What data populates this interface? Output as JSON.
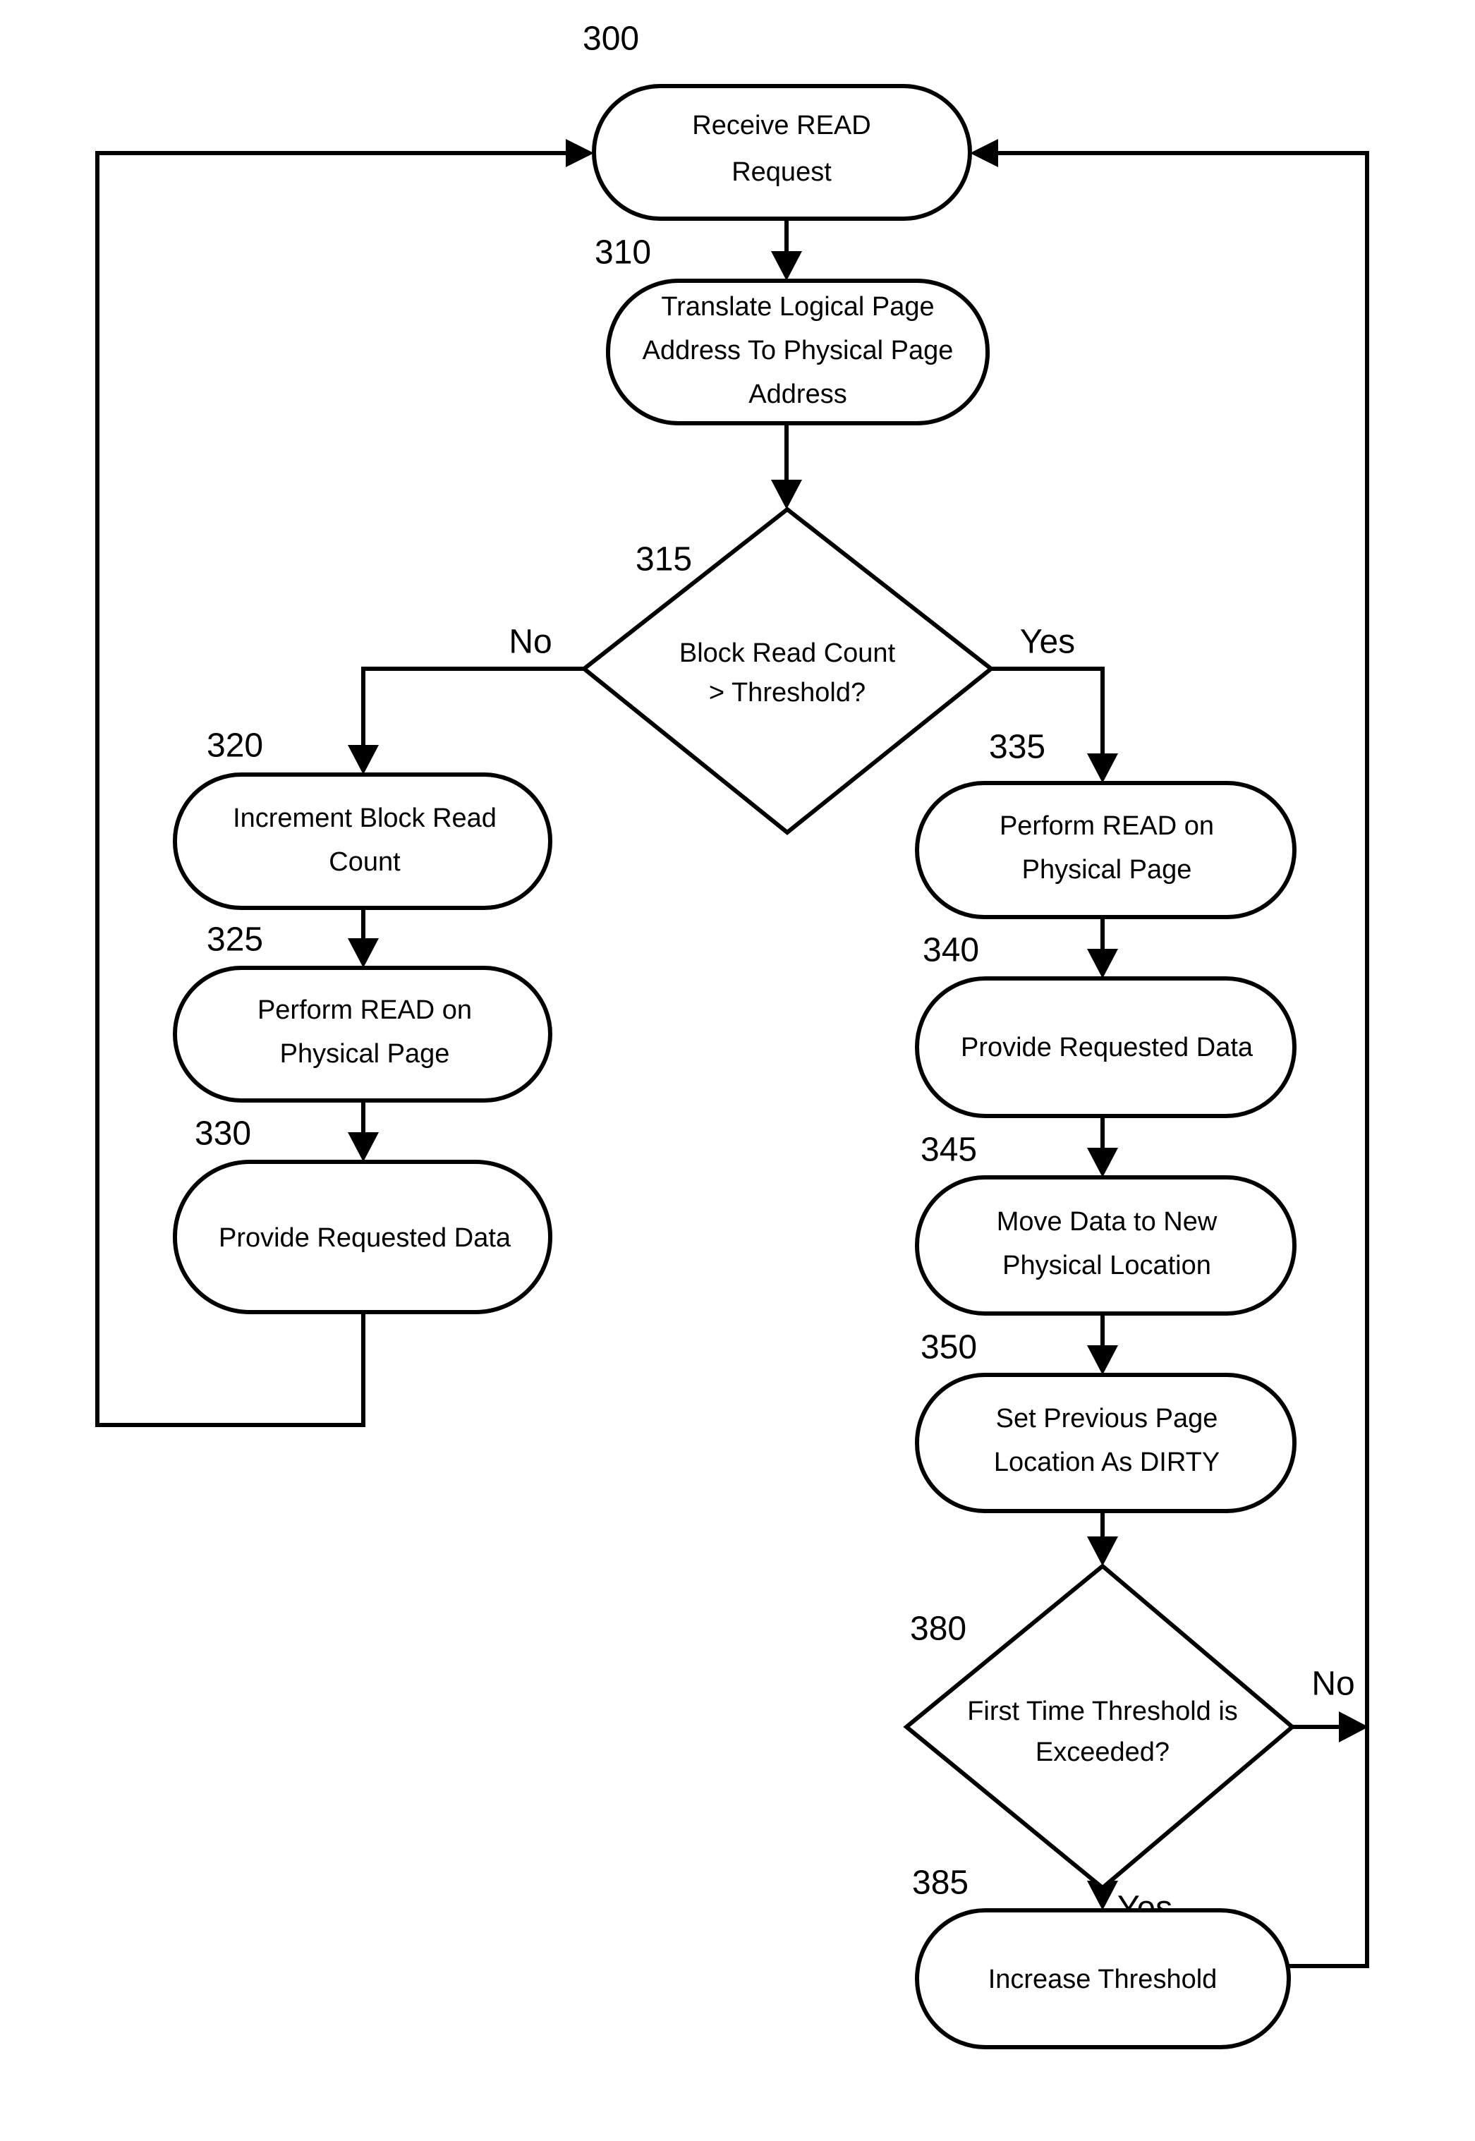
{
  "figure": {
    "type": "flowchart",
    "orientation": "top-to-bottom",
    "background_color": "#ffffff",
    "line_color": "#000000"
  },
  "nodes": {
    "n300": {
      "ref": "300",
      "shape": "rounded-rectangle",
      "lines": [
        "Receive READ",
        "Request"
      ]
    },
    "n310": {
      "ref": "310",
      "shape": "rounded-rectangle",
      "lines": [
        "Translate Logical Page",
        "Address To Physical Page",
        "Address"
      ]
    },
    "n315": {
      "ref": "315",
      "shape": "diamond",
      "lines": [
        "Block Read Count",
        "> Threshold?"
      ]
    },
    "n320": {
      "ref": "320",
      "shape": "rounded-rectangle",
      "lines": [
        "Increment Block Read",
        "Count"
      ]
    },
    "n325": {
      "ref": "325",
      "shape": "rounded-rectangle",
      "lines": [
        "Perform READ on",
        "Physical Page"
      ]
    },
    "n330": {
      "ref": "330",
      "shape": "rounded-rectangle",
      "lines": [
        "Provide Requested Data"
      ]
    },
    "n335": {
      "ref": "335",
      "shape": "rounded-rectangle",
      "lines": [
        "Perform READ on",
        "Physical Page"
      ]
    },
    "n340": {
      "ref": "340",
      "shape": "rounded-rectangle",
      "lines": [
        "Provide Requested Data"
      ]
    },
    "n345": {
      "ref": "345",
      "shape": "rounded-rectangle",
      "lines": [
        "Move Data to New",
        "Physical Location"
      ]
    },
    "n350": {
      "ref": "350",
      "shape": "rounded-rectangle",
      "lines": [
        "Set Previous Page",
        "Location As DIRTY"
      ]
    },
    "n380": {
      "ref": "380",
      "shape": "diamond",
      "lines": [
        "First Time Threshold is",
        "Exceeded?"
      ]
    },
    "n385": {
      "ref": "385",
      "shape": "rounded-rectangle",
      "lines": [
        "Increase Threshold"
      ]
    }
  },
  "edge_labels": {
    "d315_no": "No",
    "d315_yes": "Yes",
    "d380_no": "No",
    "d380_yes": "Yes"
  }
}
